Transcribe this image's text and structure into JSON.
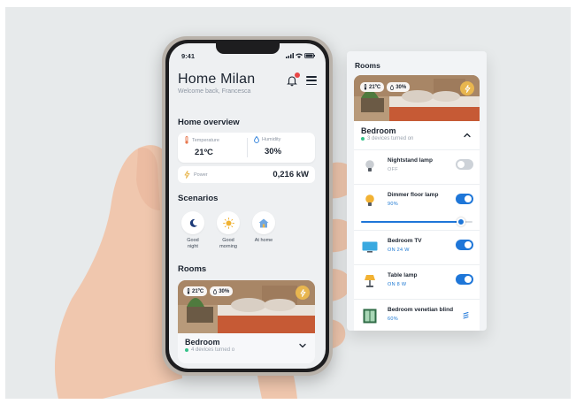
{
  "status_bar": {
    "time": "9:41"
  },
  "header": {
    "title": "Home Milan",
    "subtitle": "Welcome back, Francesca",
    "notification_count": 1
  },
  "overview": {
    "title": "Home overview",
    "temperature_label": "Temperature",
    "temperature_value": "21ºC",
    "humidity_label": "Humidity",
    "humidity_value": "30%",
    "power_label": "Power",
    "power_value": "0,216 kW"
  },
  "scenarios": {
    "title": "Scenarios",
    "items": [
      {
        "label_line1": "Good",
        "label_line2": "night",
        "icon": "moon-icon"
      },
      {
        "label_line1": "Good",
        "label_line2": "morning",
        "icon": "sun-icon"
      },
      {
        "label_line1": "At home",
        "label_line2": "",
        "icon": "house-icon"
      }
    ]
  },
  "rooms": {
    "title": "Rooms",
    "bedroom": {
      "name": "Bedroom",
      "temperature": "21ºC",
      "humidity": "30%",
      "status_phone": "4 devices turned o",
      "status_panel": "3 devices turned on"
    }
  },
  "panel": {
    "title": "Rooms",
    "devices": [
      {
        "name": "Nightstand lamp",
        "state": "OFF",
        "on": false,
        "icon": "bulb-off-icon"
      },
      {
        "name": "Dimmer floor lamp",
        "state": "90%",
        "on": true,
        "level_percent": 90,
        "icon": "bulb-on-icon"
      },
      {
        "name": "Bedroom TV",
        "state": "ON   24 W",
        "on": true,
        "icon": "tv-icon"
      },
      {
        "name": "Table lamp",
        "state": "ON   8 W",
        "on": true,
        "icon": "table-lamp-icon"
      },
      {
        "name": "Bedroom venetian blind",
        "state": "60%",
        "icon": "window-icon"
      }
    ]
  },
  "colors": {
    "accent": "#1e76d8",
    "warning": "#e8b64f",
    "online": "#35c28a",
    "background": "#e7eaeb"
  }
}
